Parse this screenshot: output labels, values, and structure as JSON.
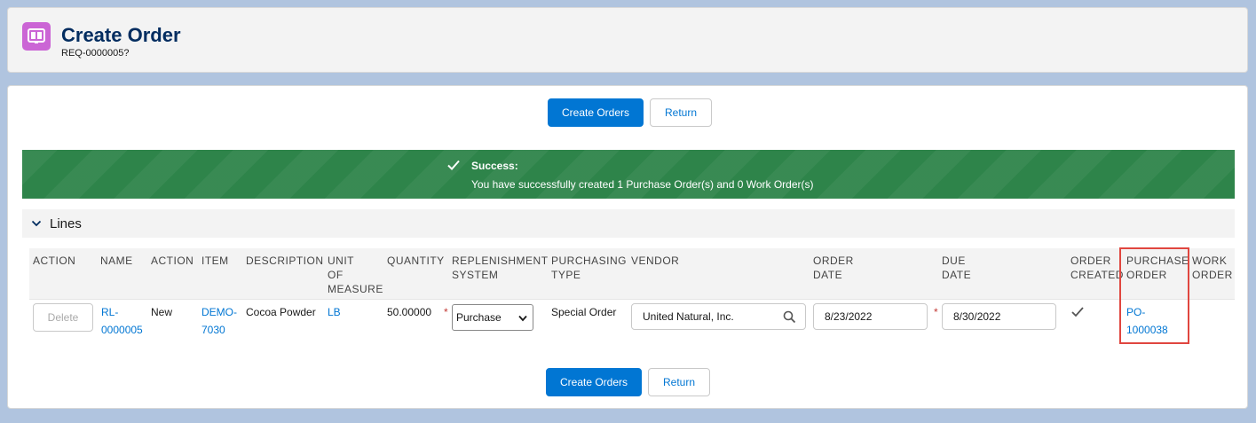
{
  "header": {
    "title": "Create Order",
    "subtitle": "REQ-0000005?"
  },
  "toolbar": {
    "create_orders_label": "Create Orders",
    "return_label": "Return"
  },
  "toast": {
    "title": "Success:",
    "message": "You have successfully created 1 Purchase Order(s) and 0 Work Order(s)",
    "color": "#2e844a"
  },
  "lines_section": {
    "title": "Lines"
  },
  "table": {
    "columns": {
      "action": "ACTION",
      "name": "NAME",
      "action2": "ACTION",
      "item": "ITEM",
      "description": "DESCRIPTION",
      "uom_1": "UNIT",
      "uom_2": "OF",
      "uom_3": "MEASURE",
      "quantity": "QUANTITY",
      "replenishment_1": "REPLENISHMENT",
      "replenishment_2": "SYSTEM",
      "purchasing_1": "PURCHASING",
      "purchasing_2": "TYPE",
      "vendor": "VENDOR",
      "order_date_1": "ORDER",
      "order_date_2": "DATE",
      "due_date_1": "DUE",
      "due_date_2": "DATE",
      "order_created_1": "ORDER",
      "order_created_2": "CREATED",
      "purchase_order_1": "PURCHASE",
      "purchase_order_2": "ORDER",
      "work_order_1": "WORK",
      "work_order_2": "ORDER"
    },
    "row": {
      "delete_label": "Delete",
      "name_1": "RL-",
      "name_2": "0000005",
      "action": "New",
      "item_1": "DEMO-",
      "item_2": "7030",
      "description": "Cocoa Powder",
      "uom": "LB",
      "quantity": "50.00000",
      "replenishment_system": "Purchase",
      "purchasing_type": "Special Order",
      "vendor": "United Natural, Inc.",
      "order_date": "8/23/2022",
      "due_date": "8/30/2022",
      "purchase_order_1": "PO-",
      "purchase_order_2": "1000038",
      "required_mark": "*"
    }
  },
  "colors": {
    "brand": "#0176d3",
    "header_title": "#032d60",
    "app_icon": "#cb65d5",
    "highlight": "#e0463f"
  }
}
